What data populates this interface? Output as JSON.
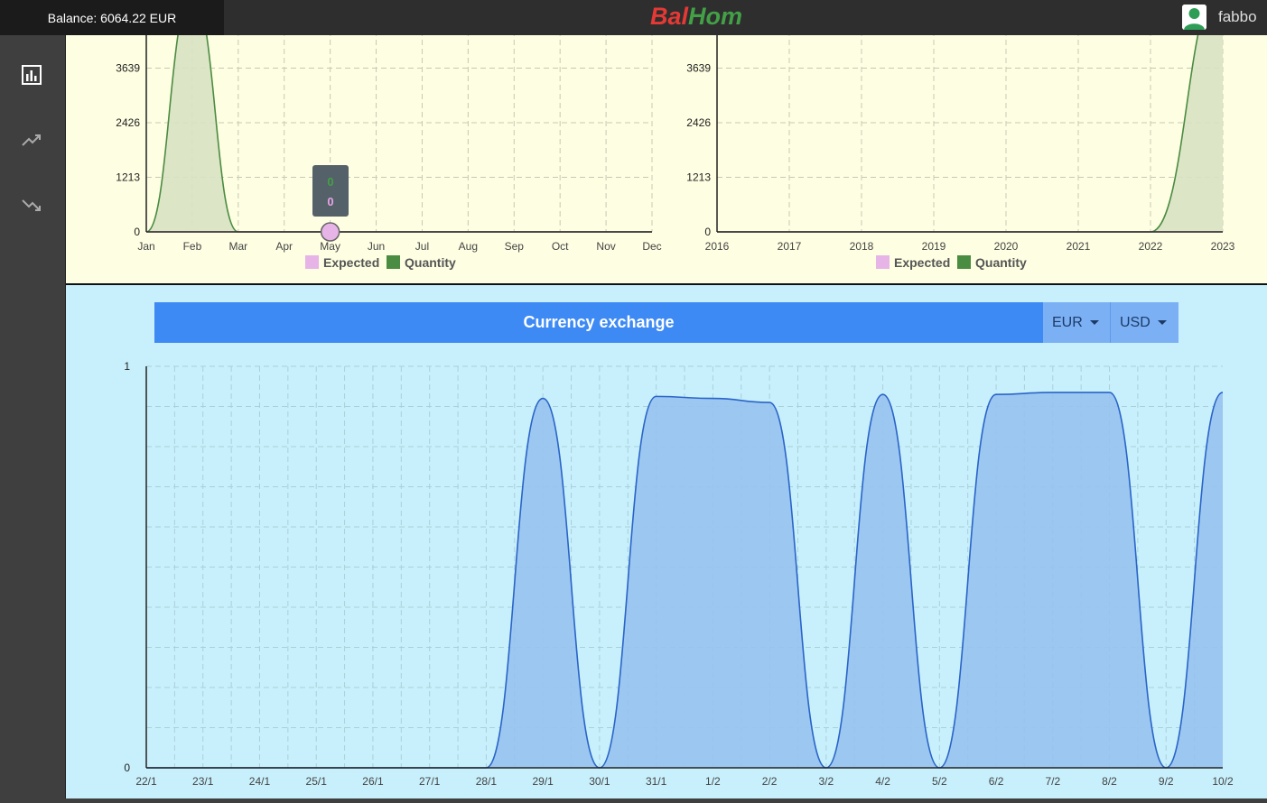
{
  "header": {
    "balance": "Balance: 6064.22 EUR",
    "brand_part1": "Bal",
    "brand_part2": "Hom",
    "username": "fabbo"
  },
  "sidebar": {
    "items": [
      {
        "icon": "bar-chart-icon"
      },
      {
        "icon": "trending-up-icon"
      },
      {
        "icon": "trending-down-icon"
      }
    ]
  },
  "colors": {
    "expected": "#e7b4e8",
    "quantity": "#4a8c41",
    "exchange_line": "#2a64c8",
    "exchange_fill": "#97c2ef"
  },
  "monthly_chart": {
    "tooltip_quantity": "0",
    "tooltip_expected": "0",
    "legend": [
      "Expected",
      "Quantity"
    ]
  },
  "yearly_chart": {
    "legend": [
      "Expected",
      "Quantity"
    ]
  },
  "exchange": {
    "title": "Currency exchange",
    "from_currency": "EUR",
    "to_currency": "USD"
  },
  "chart_data": [
    {
      "type": "area",
      "x": [
        "Jan",
        "Feb",
        "Mar",
        "Apr",
        "May",
        "Jun",
        "Jul",
        "Aug",
        "Sep",
        "Oct",
        "Nov",
        "Dec"
      ],
      "yticks": [
        0,
        1213,
        2426,
        3639
      ],
      "ylim": [
        0,
        4852
      ],
      "series": [
        {
          "name": "Expected",
          "values": [
            0,
            0,
            0,
            0,
            0,
            0,
            0,
            0,
            0,
            0,
            0,
            0
          ]
        },
        {
          "name": "Quantity",
          "values": [
            0,
            5300,
            0,
            0,
            0,
            0,
            0,
            0,
            0,
            0,
            0,
            0
          ]
        }
      ],
      "grid": true,
      "legend": "bottom"
    },
    {
      "type": "area",
      "x": [
        "2016",
        "2017",
        "2018",
        "2019",
        "2020",
        "2021",
        "2022",
        "2023"
      ],
      "yticks": [
        0,
        1213,
        2426,
        3639
      ],
      "ylim": [
        0,
        4852
      ],
      "series": [
        {
          "name": "Expected",
          "values": [
            0,
            0,
            0,
            0,
            0,
            0,
            0,
            0
          ]
        },
        {
          "name": "Quantity",
          "values": [
            0,
            0,
            0,
            0,
            0,
            0,
            0,
            5600
          ]
        }
      ],
      "grid": true,
      "legend": "bottom"
    },
    {
      "type": "area",
      "title": "Currency exchange",
      "x": [
        "22/1",
        "23/1",
        "24/1",
        "25/1",
        "26/1",
        "27/1",
        "28/1",
        "29/1",
        "30/1",
        "31/1",
        "1/2",
        "2/2",
        "3/2",
        "4/2",
        "5/2",
        "6/2",
        "7/2",
        "8/2",
        "9/2",
        "10/2"
      ],
      "yticks": [
        0,
        1
      ],
      "ylim": [
        0,
        1
      ],
      "series": [
        {
          "values": [
            0,
            0,
            0,
            0,
            0,
            0,
            0,
            0.92,
            0,
            0.925,
            0.92,
            0.91,
            0,
            0.93,
            0,
            0.93,
            0.935,
            0.935,
            0,
            0.935
          ]
        }
      ],
      "grid": true
    }
  ]
}
